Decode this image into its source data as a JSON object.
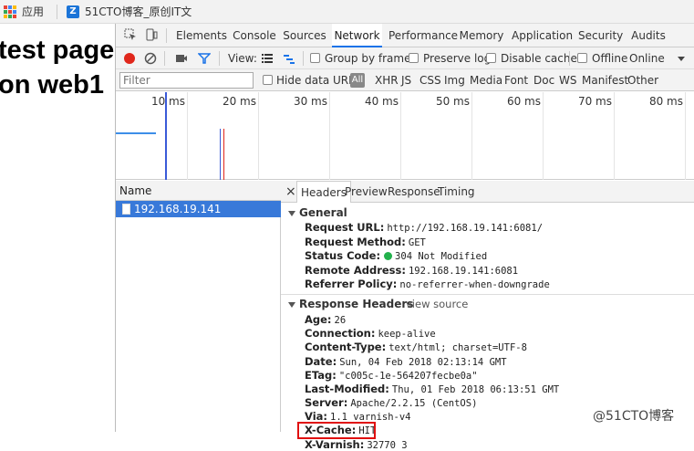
{
  "bookmarks": {
    "apps_label": "应用",
    "site_label": "51CTO博客_原创IT文"
  },
  "page": {
    "heading": "test page on web1"
  },
  "devtools": {
    "tabs": [
      "Elements",
      "Console",
      "Sources",
      "Network",
      "Performance",
      "Memory",
      "Application",
      "Security",
      "Audits"
    ],
    "active_tab": "Network",
    "toolbar": {
      "view_label": "View:",
      "group_by_frame": "Group by frame",
      "preserve_log": "Preserve log",
      "disable_cache": "Disable cache",
      "offline": "Offline",
      "throttle": "Online"
    },
    "filter": {
      "placeholder": "Filter",
      "hide_data_urls": "Hide data URLs",
      "all": "All",
      "types": [
        "XHR",
        "JS",
        "CSS",
        "Img",
        "Media",
        "Font",
        "Doc",
        "WS",
        "Manifest",
        "Other"
      ]
    },
    "timeline": {
      "labels": [
        "10 ms",
        "20 ms",
        "30 ms",
        "40 ms",
        "50 ms",
        "60 ms",
        "70 ms",
        "80 ms"
      ]
    },
    "requests": {
      "name_header": "Name",
      "rows": [
        "192.168.19.141"
      ]
    },
    "details": {
      "close": "×",
      "tabs": [
        "Headers",
        "Preview",
        "Response",
        "Timing"
      ],
      "general": {
        "title": "General",
        "request_url_k": "Request URL:",
        "request_url_v": "http://192.168.19.141:6081/",
        "method_k": "Request Method:",
        "method_v": "GET",
        "status_k": "Status Code:",
        "status_v": "304 Not Modified",
        "remote_k": "Remote Address:",
        "remote_v": "192.168.19.141:6081",
        "referrer_k": "Referrer Policy:",
        "referrer_v": "no-referrer-when-downgrade"
      },
      "response": {
        "title": "Response Headers",
        "view_source": "view source",
        "headers": [
          {
            "k": "Age:",
            "v": "26"
          },
          {
            "k": "Connection:",
            "v": "keep-alive"
          },
          {
            "k": "Content-Type:",
            "v": "text/html; charset=UTF-8"
          },
          {
            "k": "Date:",
            "v": "Sun, 04 Feb 2018 02:13:14 GMT"
          },
          {
            "k": "ETag:",
            "v": "\"c005c-1e-564207fecbe0a\""
          },
          {
            "k": "Last-Modified:",
            "v": "Thu, 01 Feb 2018 06:13:51 GMT"
          },
          {
            "k": "Server:",
            "v": "Apache/2.2.15 (CentOS)"
          },
          {
            "k": "Via:",
            "v": "1.1 varnish-v4"
          },
          {
            "k": "X-Cache:",
            "v": "HIT"
          },
          {
            "k": "X-Varnish:",
            "v": "32770 3"
          }
        ]
      }
    }
  },
  "watermark": "@51CTO博客",
  "colors": {
    "accent": "#1a73e8",
    "selected_row": "#3879d9",
    "record": "#e0271b",
    "status_ok": "#22b14c",
    "highlight_box": "#e01010"
  }
}
